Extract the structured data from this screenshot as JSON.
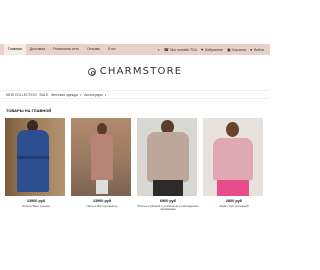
{
  "top_nav": {
    "items": [
      "Главная",
      "Доставка",
      "Розничная сеть",
      "Отзывы",
      "Блог"
    ],
    "active_index": 0
  },
  "top_right": {
    "phone": "Мы онлайн 7/24",
    "wishlist": "Избранное",
    "cart": "Корзина",
    "account": "Войти"
  },
  "logo": {
    "text": "CHARMSTORE"
  },
  "category_nav": {
    "items": [
      "NEW COLLECTION",
      "SALE",
      "Женская одежда",
      "Аксессуары"
    ]
  },
  "section": {
    "title": "ТОВАРЫ НА ГЛАВНОЙ"
  },
  "products": [
    {
      "price": "13900 руб",
      "name": "Пальто Виго (синее)"
    },
    {
      "price": "13900 руб",
      "name": "Пальто Виго (розовое)"
    },
    {
      "price": "6900 руб",
      "name": "Платье-рубашка с ремешком и накладными карманами"
    },
    {
      "price": "2800 руб",
      "name": "Жакет Луи (розовый)"
    }
  ],
  "colors": {
    "topbar": "#e8d2c7",
    "accent": "#e84c8b"
  }
}
